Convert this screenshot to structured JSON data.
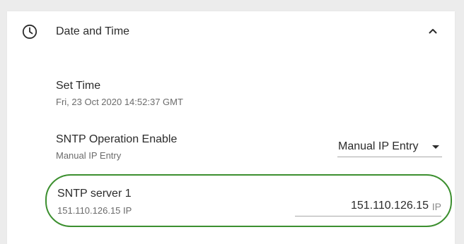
{
  "section": {
    "title": "Date and Time",
    "icon": "clock-icon",
    "toggle_icon": "chevron-up-icon"
  },
  "set_time": {
    "label": "Set Time",
    "value": "Fri, 23 Oct 2020 14:52:37 GMT"
  },
  "sntp_operation": {
    "label": "SNTP Operation Enable",
    "value": "Manual IP Entry",
    "selected": "Manual IP Entry"
  },
  "sntp_server_1": {
    "label": "SNTP server 1",
    "value": "151.110.126.15 IP",
    "input_value": "151.110.126.15",
    "suffix": "IP"
  },
  "colors": {
    "highlight": "#3c8f2f",
    "text": "#2b2b2b",
    "subtext": "#6b6b6b",
    "background": "#ececec",
    "card": "#ffffff"
  }
}
